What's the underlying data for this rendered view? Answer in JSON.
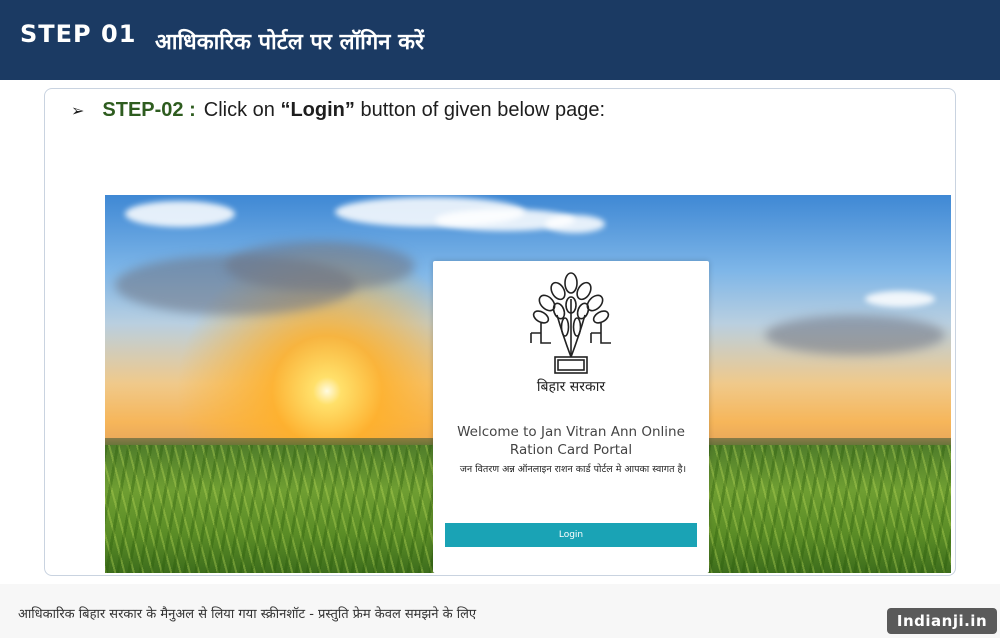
{
  "header": {
    "step_number": "STEP 01",
    "title": "आधिकारिक पोर्टल पर लॉगिन करें"
  },
  "instruction": {
    "bullet_icon": "arrow-bullet-icon",
    "step_label": "STEP-02 :",
    "text_before": "Click on ",
    "button_name": "“Login”",
    "text_after": " button of given below page:"
  },
  "portal": {
    "emblem_icon": "bihar-government-emblem-icon",
    "emblem_caption": "बिहार सरकार",
    "welcome_line1": "Welcome to Jan Vitran Ann Online",
    "welcome_line2": "Ration Card Portal",
    "welcome_hindi": "जन वितरण अन्न ऑनलाइन राशन कार्ड पोर्टल मे आपका स्वागत है।",
    "login_label": "Login"
  },
  "footer": {
    "caption": "आधिकारिक बिहार सरकार के मैनुअल से लिया गया स्क्रीनशॉट - प्रस्तुति फ्रेम केवल समझने के लिए",
    "watermark": "Indianji.in"
  },
  "colors": {
    "header_bg": "#1b3a63",
    "step_label": "#2e5c1f",
    "login_button": "#1aa3b5"
  }
}
